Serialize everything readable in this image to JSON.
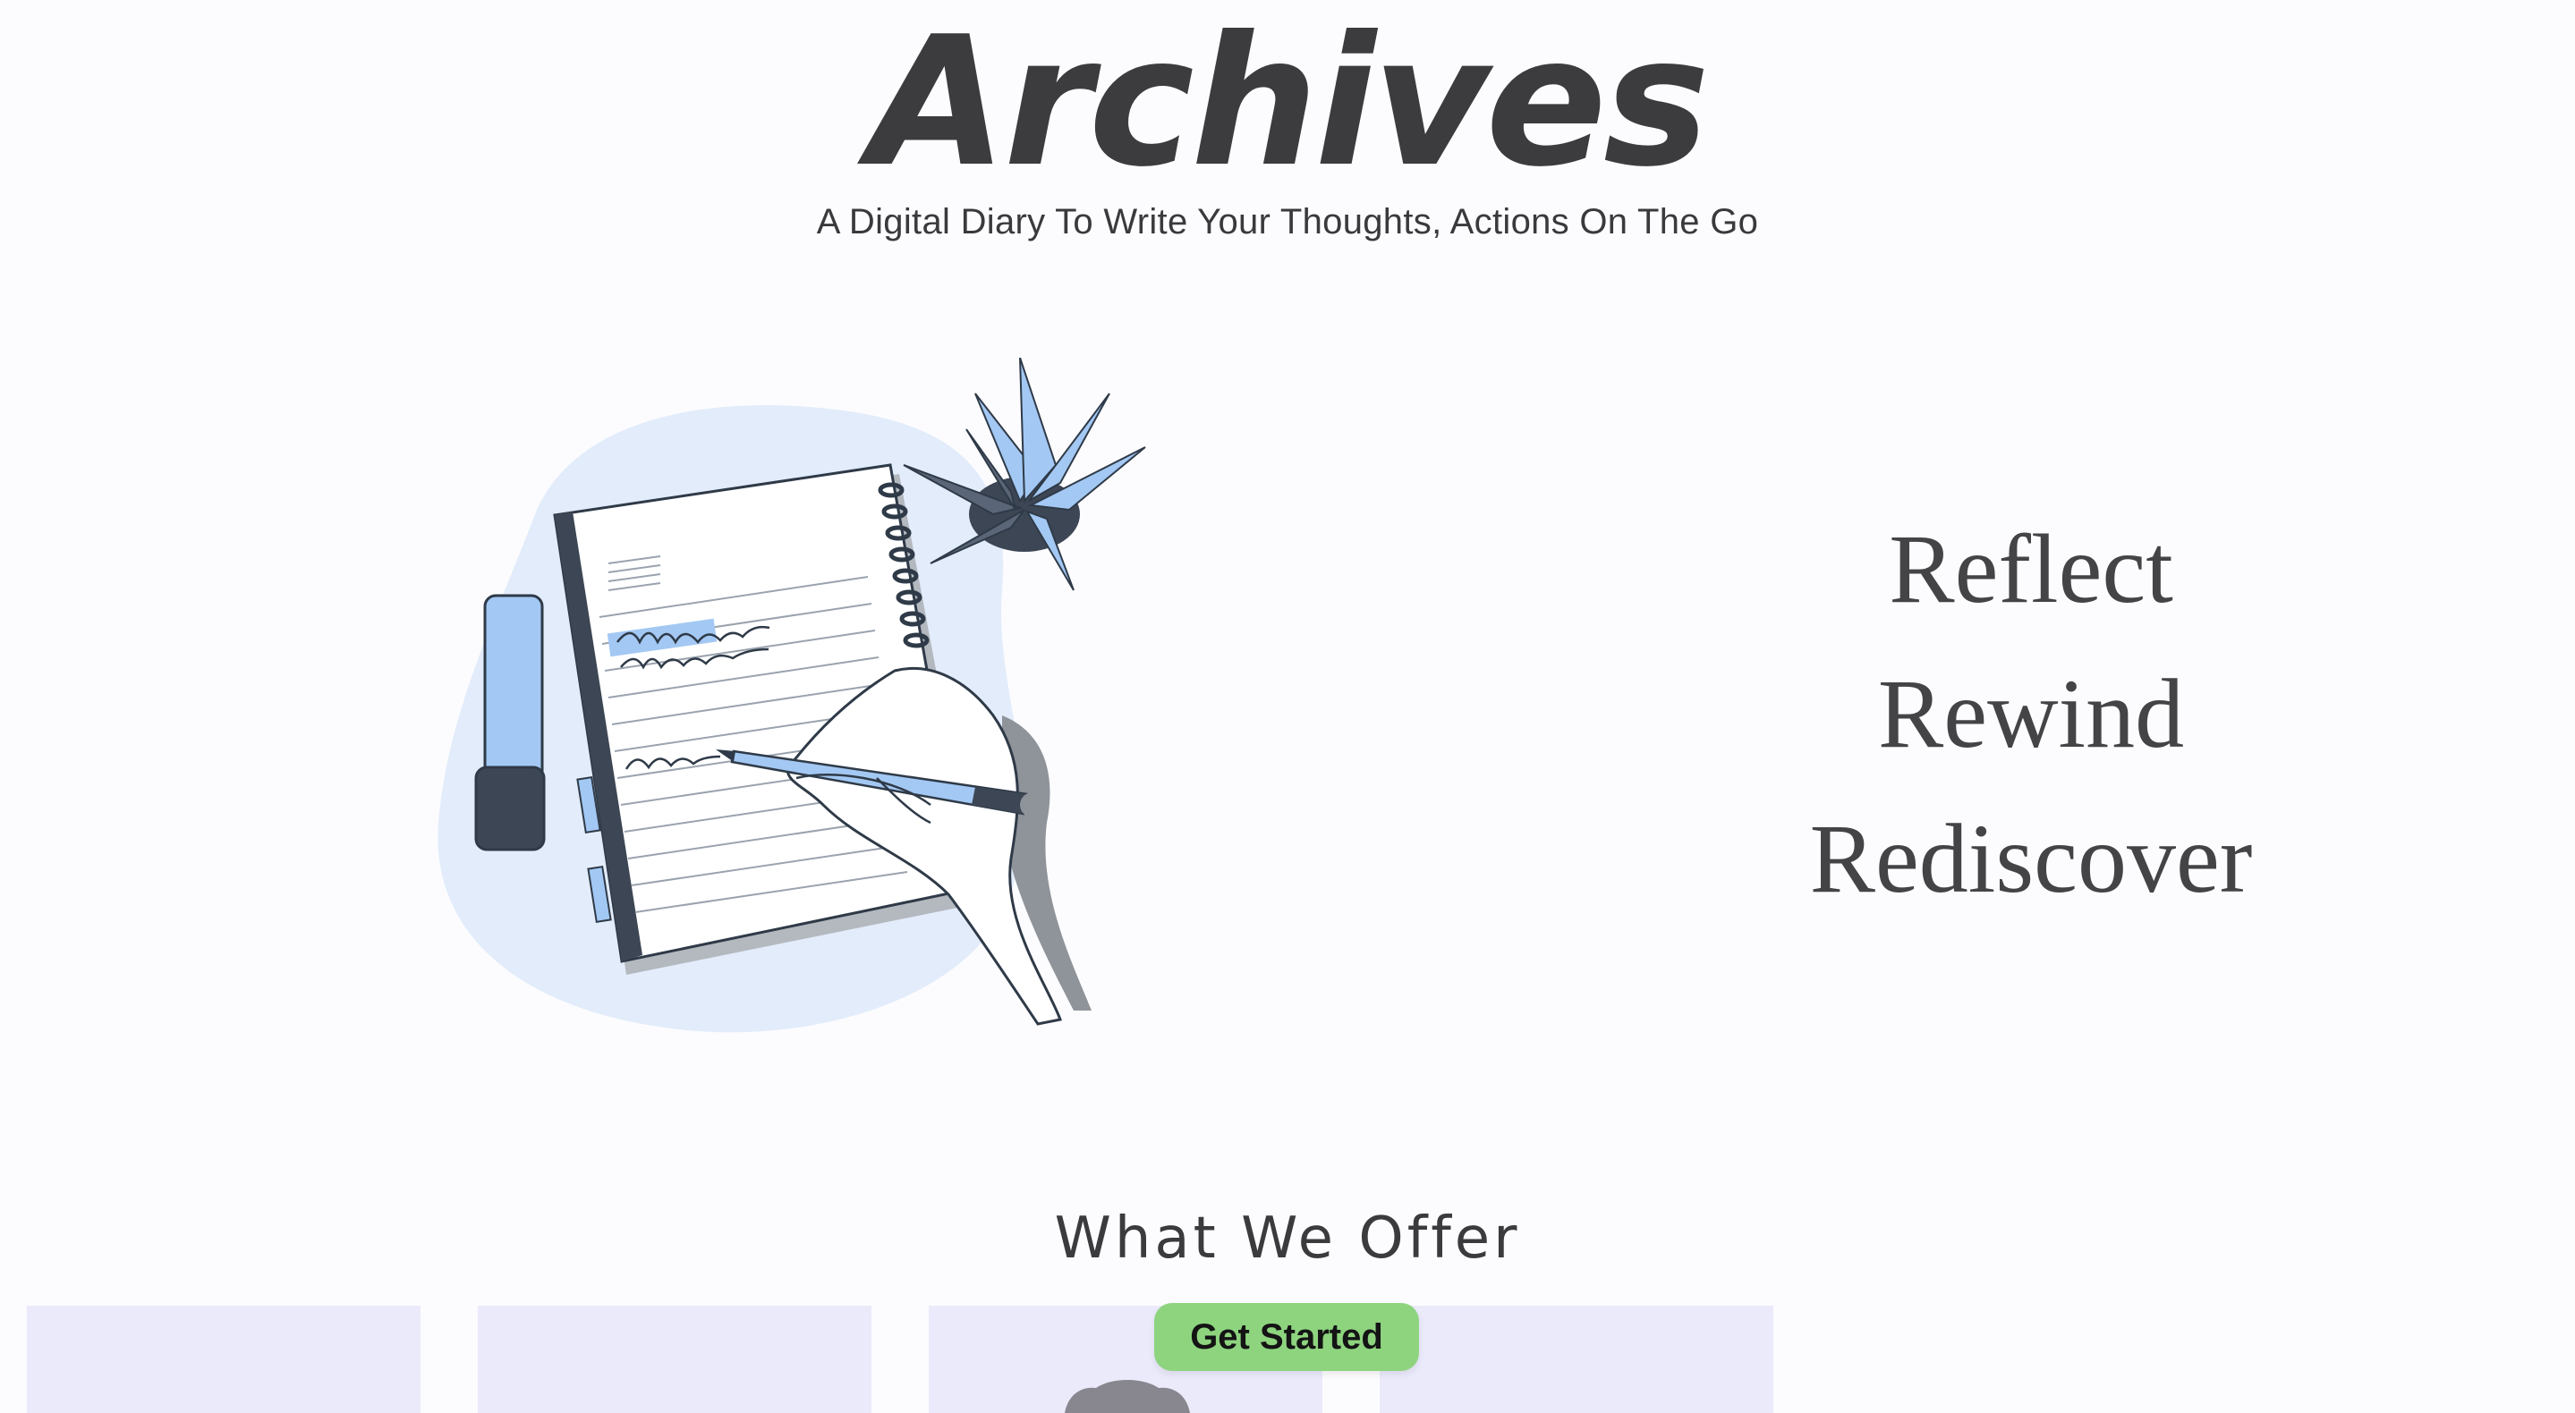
{
  "header": {
    "title": "Archives",
    "subtitle": "A Digital Diary To Write Your Thoughts, Actions On The Go"
  },
  "hero": {
    "illustration": "diary-writing-illustration",
    "tagline": [
      "Reflect",
      "Rewind",
      "Rediscover"
    ]
  },
  "offer": {
    "heading": "What We Offer",
    "cta_label": "Get Started"
  },
  "colors": {
    "background": "#fcfcfe",
    "text": "#3f3f41",
    "card": "#ebeafb",
    "cta": "#8ed47f",
    "illustration_accent": "#a3c8f3"
  }
}
